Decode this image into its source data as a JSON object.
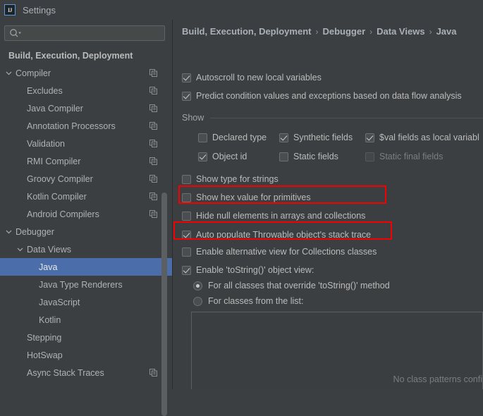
{
  "window": {
    "title": "Settings",
    "app_icon": "intellij-idea-icon"
  },
  "sidebar": {
    "search": {
      "value": "",
      "placeholder": "",
      "icon": "search-icon"
    },
    "items": [
      {
        "label": "Build, Execution, Deployment",
        "indent": 0,
        "chevron": "none",
        "bold": true,
        "copy": false,
        "selected": false
      },
      {
        "label": "Compiler",
        "indent": 1,
        "chevron": "down",
        "bold": false,
        "copy": true,
        "selected": false
      },
      {
        "label": "Excludes",
        "indent": 2,
        "chevron": "none",
        "bold": false,
        "copy": true,
        "selected": false
      },
      {
        "label": "Java Compiler",
        "indent": 2,
        "chevron": "none",
        "bold": false,
        "copy": true,
        "selected": false
      },
      {
        "label": "Annotation Processors",
        "indent": 2,
        "chevron": "none",
        "bold": false,
        "copy": true,
        "selected": false
      },
      {
        "label": "Validation",
        "indent": 2,
        "chevron": "none",
        "bold": false,
        "copy": true,
        "selected": false
      },
      {
        "label": "RMI Compiler",
        "indent": 2,
        "chevron": "none",
        "bold": false,
        "copy": true,
        "selected": false
      },
      {
        "label": "Groovy Compiler",
        "indent": 2,
        "chevron": "none",
        "bold": false,
        "copy": true,
        "selected": false
      },
      {
        "label": "Kotlin Compiler",
        "indent": 2,
        "chevron": "none",
        "bold": false,
        "copy": true,
        "selected": false
      },
      {
        "label": "Android Compilers",
        "indent": 2,
        "chevron": "none",
        "bold": false,
        "copy": true,
        "selected": false
      },
      {
        "label": "Debugger",
        "indent": 1,
        "chevron": "down",
        "bold": false,
        "copy": false,
        "selected": false
      },
      {
        "label": "Data Views",
        "indent": 2,
        "chevron": "down",
        "bold": false,
        "copy": false,
        "selected": false
      },
      {
        "label": "Java",
        "indent": 3,
        "chevron": "none",
        "bold": false,
        "copy": false,
        "selected": true
      },
      {
        "label": "Java Type Renderers",
        "indent": 3,
        "chevron": "none",
        "bold": false,
        "copy": false,
        "selected": false
      },
      {
        "label": "JavaScript",
        "indent": 3,
        "chevron": "none",
        "bold": false,
        "copy": false,
        "selected": false
      },
      {
        "label": "Kotlin",
        "indent": 3,
        "chevron": "none",
        "bold": false,
        "copy": false,
        "selected": false
      },
      {
        "label": "Stepping",
        "indent": 2,
        "chevron": "none",
        "bold": false,
        "copy": false,
        "selected": false
      },
      {
        "label": "HotSwap",
        "indent": 2,
        "chevron": "none",
        "bold": false,
        "copy": false,
        "selected": false
      },
      {
        "label": "Async Stack Traces",
        "indent": 2,
        "chevron": "none",
        "bold": false,
        "copy": true,
        "selected": false
      }
    ]
  },
  "main": {
    "breadcrumb": [
      "Build, Execution, Deployment",
      "Debugger",
      "Data Views",
      "Java"
    ],
    "breadcrumb_separator": "›",
    "top_options": [
      {
        "label": "Autoscroll to new local variables",
        "checked": true,
        "disabled": false
      },
      {
        "label": "Predict condition values and exceptions based on data flow analysis",
        "checked": true,
        "disabled": false
      }
    ],
    "show_group": {
      "title": "Show",
      "options": [
        {
          "label": "Declared type",
          "checked": false,
          "disabled": false
        },
        {
          "label": "Synthetic fields",
          "checked": true,
          "disabled": false
        },
        {
          "label": "$val fields as local variabl",
          "checked": true,
          "disabled": false
        },
        {
          "label": "Object id",
          "checked": true,
          "disabled": false
        },
        {
          "label": "Static fields",
          "checked": false,
          "disabled": false
        },
        {
          "label": "Static final fields",
          "checked": false,
          "disabled": true
        }
      ]
    },
    "options": [
      {
        "label": "Show type for strings",
        "checked": false,
        "disabled": false,
        "highlighted": false
      },
      {
        "label": "Show hex value for primitives",
        "checked": false,
        "disabled": false,
        "highlighted": false
      },
      {
        "label": "Hide null elements in arrays and collections",
        "checked": false,
        "disabled": false,
        "highlighted": true
      },
      {
        "label": "Auto populate Throwable object's stack trace",
        "checked": true,
        "disabled": false,
        "highlighted": false
      },
      {
        "label": "Enable alternative view for Collections classes",
        "checked": false,
        "disabled": false,
        "highlighted": true
      },
      {
        "label": "Enable 'toString()' object view:",
        "checked": true,
        "disabled": false,
        "highlighted": false
      }
    ],
    "tostring_radios": [
      {
        "label": "For all classes that override 'toString()' method",
        "selected": true
      },
      {
        "label": "For classes from the list:",
        "selected": false
      }
    ],
    "patterns_empty_text": "No class patterns confi"
  },
  "colors": {
    "background": "#3C3F41",
    "selection": "#4B6EAB",
    "text": "#BBBBBB",
    "annotation": "#F50000",
    "list_background": "#3B3E40"
  }
}
